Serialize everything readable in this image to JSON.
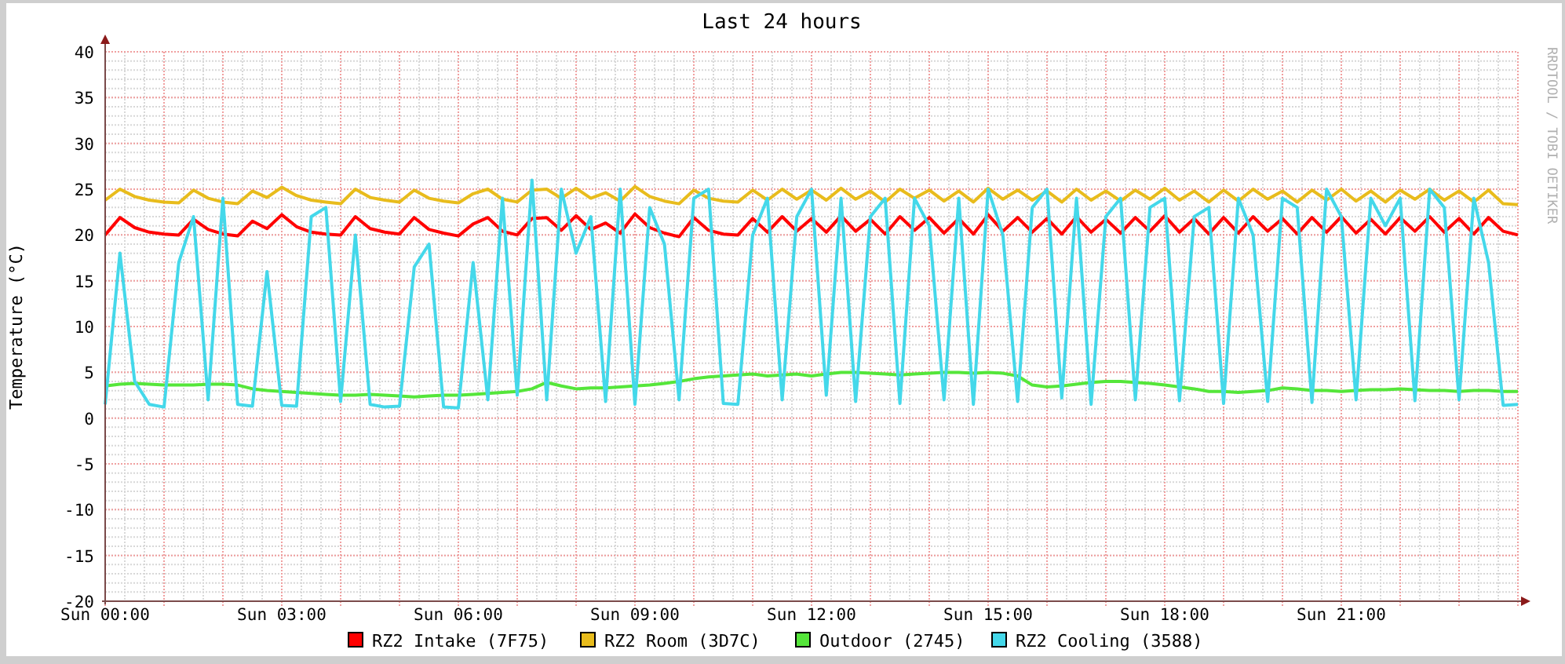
{
  "credit": "RRDTOOL / TOBI OETIKER",
  "chart_data": {
    "type": "line",
    "title": "Last 24 hours",
    "ylabel": "Temperature (°C)",
    "categories": [
      "Sun 00:00",
      null,
      null,
      null,
      null,
      null,
      null,
      null,
      null,
      null,
      null,
      null,
      "Sun 03:00",
      null,
      null,
      null,
      null,
      null,
      null,
      null,
      null,
      null,
      null,
      null,
      "Sun 06:00",
      null,
      null,
      null,
      null,
      null,
      null,
      null,
      null,
      null,
      null,
      null,
      "Sun 09:00",
      null,
      null,
      null,
      null,
      null,
      null,
      null,
      null,
      null,
      null,
      null,
      "Sun 12:00",
      null,
      null,
      null,
      null,
      null,
      null,
      null,
      null,
      null,
      null,
      null,
      "Sun 15:00",
      null,
      null,
      null,
      null,
      null,
      null,
      null,
      null,
      null,
      null,
      null,
      "Sun 18:00",
      null,
      null,
      null,
      null,
      null,
      null,
      null,
      null,
      null,
      null,
      null,
      "Sun 21:00",
      null,
      null,
      null,
      null,
      null,
      null,
      null,
      null,
      null,
      null,
      null,
      null
    ],
    "ylim": [
      -20,
      40
    ],
    "grid": true,
    "legend": "bottom",
    "yticks": [
      -20,
      -15,
      -10,
      -5,
      0,
      5,
      10,
      15,
      20,
      25,
      30,
      35,
      40
    ],
    "series": [
      {
        "name": "RZ2 Intake (7F75)",
        "color": "#ff0000",
        "values": [
          20,
          21.9,
          20.8,
          20.3,
          20.1,
          20,
          21.7,
          20.6,
          20.1,
          19.9,
          21.5,
          20.7,
          22.2,
          20.9,
          20.3,
          20.1,
          20,
          22,
          20.7,
          20.3,
          20.1,
          21.9,
          20.6,
          20.2,
          19.9,
          21.2,
          21.9,
          20.4,
          20,
          21.8,
          21.9,
          20.5,
          22.1,
          20.6,
          21.3,
          20.2,
          22.3,
          20.8,
          20.2,
          19.8,
          21.9,
          20.5,
          20.1,
          20,
          21.8,
          20.3,
          22,
          20.4,
          21.8,
          20.3,
          22.1,
          20.4,
          21.7,
          20.1,
          22,
          20.5,
          21.9,
          20.2,
          21.8,
          20.1,
          22.2,
          20.4,
          21.9,
          20.3,
          21.8,
          20.1,
          22,
          20.3,
          21.7,
          20.2,
          21.9,
          20.4,
          22.1,
          20.3,
          21.8,
          20.1,
          21.9,
          20.2,
          22,
          20.4,
          21.8,
          20.1,
          21.9,
          20.3,
          22,
          20.2,
          21.7,
          20.1,
          21.9,
          20.4,
          22,
          20.3,
          21.8,
          20.1,
          21.9,
          20.4,
          20
        ]
      },
      {
        "name": "RZ2 Room (3D7C)",
        "color": "#e8bc1c",
        "values": [
          23.8,
          25,
          24.2,
          23.8,
          23.6,
          23.5,
          24.9,
          24,
          23.6,
          23.4,
          24.8,
          24.1,
          25.2,
          24.3,
          23.8,
          23.6,
          23.4,
          25,
          24.1,
          23.8,
          23.6,
          24.9,
          24,
          23.7,
          23.5,
          24.5,
          25,
          23.9,
          23.6,
          24.9,
          25,
          24,
          25.1,
          24,
          24.6,
          23.7,
          25.3,
          24.2,
          23.7,
          23.4,
          24.9,
          24,
          23.7,
          23.6,
          24.9,
          23.8,
          25,
          23.9,
          24.9,
          23.8,
          25.1,
          23.9,
          24.8,
          23.6,
          25,
          24,
          24.9,
          23.7,
          24.8,
          23.6,
          25.1,
          23.9,
          24.9,
          23.8,
          24.8,
          23.6,
          25,
          23.8,
          24.8,
          23.7,
          24.9,
          23.9,
          25.1,
          23.8,
          24.8,
          23.6,
          24.9,
          23.7,
          25,
          23.9,
          24.8,
          23.6,
          24.9,
          23.8,
          25,
          23.7,
          24.8,
          23.6,
          24.9,
          23.9,
          25,
          23.8,
          24.8,
          23.6,
          24.9,
          23.4,
          23.3
        ]
      },
      {
        "name": "Outdoor (2745)",
        "color": "#55e63a",
        "values": [
          3.5,
          3.7,
          3.8,
          3.7,
          3.6,
          3.6,
          3.6,
          3.7,
          3.7,
          3.6,
          3.2,
          3,
          2.9,
          2.8,
          2.7,
          2.6,
          2.5,
          2.5,
          2.6,
          2.5,
          2.4,
          2.3,
          2.4,
          2.5,
          2.5,
          2.6,
          2.7,
          2.8,
          2.9,
          3.2,
          3.9,
          3.5,
          3.2,
          3.3,
          3.3,
          3.4,
          3.5,
          3.6,
          3.8,
          4,
          4.3,
          4.5,
          4.6,
          4.7,
          4.8,
          4.6,
          4.7,
          4.8,
          4.6,
          4.8,
          5,
          5,
          4.9,
          4.8,
          4.7,
          4.8,
          4.9,
          5,
          5,
          4.9,
          5,
          4.9,
          4.6,
          3.6,
          3.4,
          3.5,
          3.7,
          3.9,
          4,
          4,
          3.9,
          3.8,
          3.6,
          3.4,
          3.2,
          2.9,
          2.9,
          2.8,
          2.9,
          3,
          3.3,
          3.2,
          3,
          3,
          2.9,
          3,
          3.1,
          3.1,
          3.2,
          3.1,
          3,
          3,
          2.9,
          3,
          3,
          2.9,
          2.9
        ]
      },
      {
        "name": "RZ2 Cooling (3588)",
        "color": "#44d8ea",
        "values": [
          1.5,
          18,
          4,
          1.5,
          1.2,
          17,
          22,
          2,
          24,
          1.5,
          1.3,
          16,
          1.4,
          1.3,
          22,
          23,
          1.8,
          20,
          1.5,
          1.2,
          1.3,
          16.5,
          19,
          1.2,
          1.1,
          17,
          2,
          24,
          2.5,
          26,
          2,
          25,
          18,
          22,
          1.8,
          25,
          1.5,
          23,
          19,
          2,
          24,
          25,
          1.6,
          1.5,
          20,
          24,
          2,
          22,
          25,
          2.5,
          24,
          1.8,
          22,
          24,
          1.6,
          24,
          21,
          2,
          24,
          1.5,
          25,
          20,
          1.8,
          23,
          25,
          2.2,
          24,
          1.5,
          22,
          24,
          2,
          23,
          24,
          1.9,
          22,
          23,
          1.6,
          24,
          20,
          1.8,
          24,
          23,
          1.7,
          25,
          22,
          2,
          24,
          21,
          24,
          1.9,
          25,
          23,
          2,
          24,
          17,
          1.4,
          1.5
        ]
      }
    ]
  }
}
